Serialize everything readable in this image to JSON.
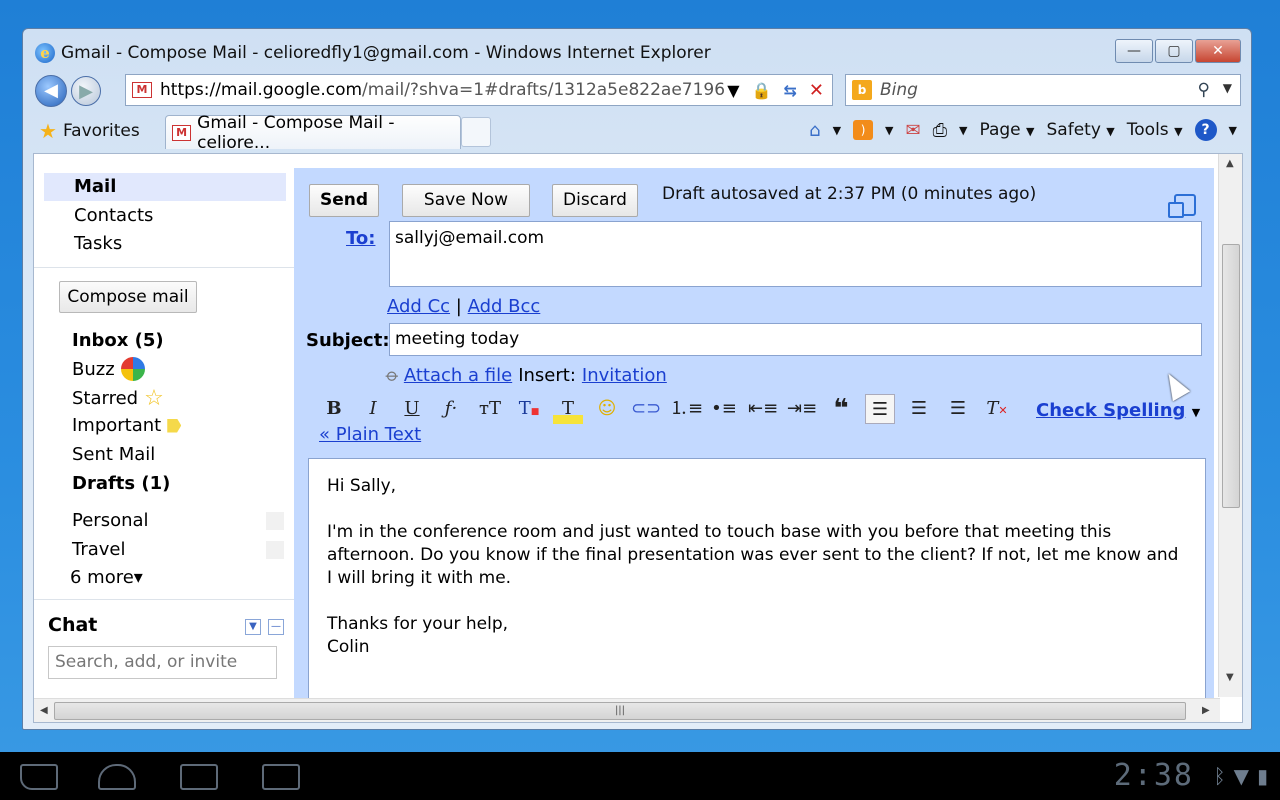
{
  "window": {
    "title": "Gmail - Compose Mail - celioredfly1@gmail.com - Windows Internet Explorer",
    "minimize": "—",
    "maximize": "▢",
    "close": "✕"
  },
  "nav": {
    "back": "◀",
    "forward": "▶",
    "url_domain": "https://mail.google.com",
    "url_rest": "/mail/?shva=1#drafts/1312a5e822ae7196",
    "search_placeholder": "Bing"
  },
  "favbar": {
    "favorites_label": "Favorites",
    "tab_title": "Gmail - Compose Mail - celiore...",
    "commands": [
      "Page",
      "Safety",
      "Tools"
    ]
  },
  "sidebar": {
    "nav": [
      "Mail",
      "Contacts",
      "Tasks"
    ],
    "compose": "Compose mail",
    "folders": {
      "inbox": "Inbox (5)",
      "buzz": "Buzz",
      "starred": "Starred",
      "important": "Important",
      "sent": "Sent Mail",
      "drafts": "Drafts (1)"
    },
    "labels": [
      "Personal",
      "Travel"
    ],
    "more": "6 more▾",
    "chat_title": "Chat",
    "chat_placeholder": "Search, add, or invite"
  },
  "compose": {
    "send": "Send",
    "save": "Save Now",
    "discard": "Discard",
    "autosave": "Draft autosaved at 2:37 PM (0 minutes ago)",
    "to_label": "To:",
    "to_value": "sallyj@email.com",
    "add_cc": "Add Cc",
    "add_bcc": "Add Bcc",
    "cc_separator": "|",
    "subject_label": "Subject:",
    "subject_value": "meeting today",
    "attach": "Attach a file",
    "insert_label": "Insert:",
    "invitation": "Invitation",
    "check_spelling": "Check Spelling",
    "plain_text": "« Plain Text",
    "body": "Hi Sally,\n\nI'm in the conference room and just wanted to touch base with you before that meeting this afternoon. Do you know if the final presentation was ever sent to the client? If not, let me know and I will bring it with me.\n\nThanks for your help,\nColin"
  },
  "toolbar_icons": [
    "bold-icon",
    "italic-icon",
    "underline-icon",
    "font-icon",
    "font-size-icon",
    "text-color-icon",
    "highlight-icon",
    "emoticon-icon",
    "link-icon",
    "numbered-list-icon",
    "bullet-list-icon",
    "outdent-icon",
    "indent-icon",
    "quote-icon",
    "align-left-icon",
    "align-center-icon",
    "align-right-icon",
    "remove-formatting-icon"
  ],
  "system": {
    "clock": "2:38"
  },
  "colors": {
    "compose_bg": "#c3d9ff",
    "link": "#1a3fd0",
    "selected_nav": "#e1e8fd"
  }
}
